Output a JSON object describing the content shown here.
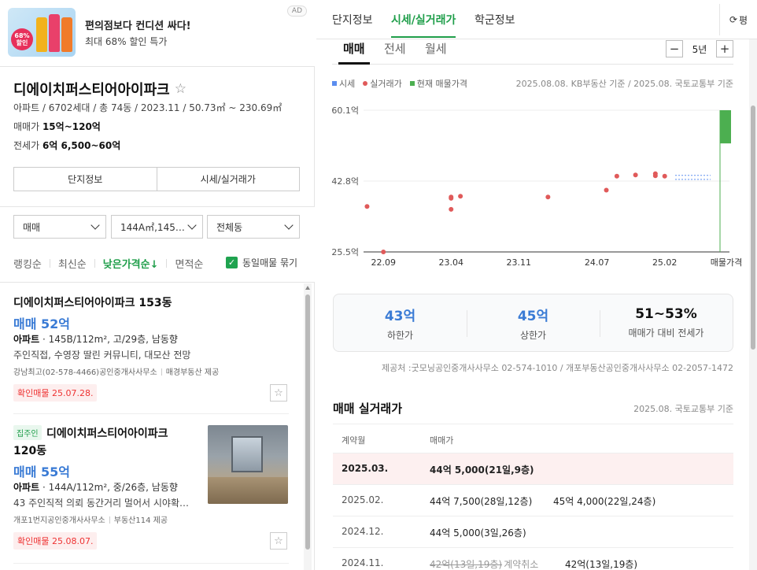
{
  "ad": {
    "title": "편의점보다 컨디션 싸다!",
    "subtitle": "최대 68% 할인 특가",
    "tag": "AD",
    "badge": "68%",
    "badge_sub": "할인"
  },
  "complex": {
    "name": "디에이치퍼스티어아이파크",
    "meta": "아파트 / 6702세대 / 총 74동 / 2023.11 / 50.73㎡ ~ 230.69㎡",
    "sale_label": "매매가",
    "sale_value": "15억~120억",
    "jeonse_label": "전세가",
    "jeonse_value": "6억 6,500~60억",
    "buttons": [
      "단지정보",
      "시세/실거래가"
    ]
  },
  "filters": {
    "trade_type": "매매",
    "area": "144A㎡,145…",
    "building": "전체동",
    "sort_options": [
      "랭킹순",
      "최신순",
      "낮은가격순↓",
      "면적순"
    ],
    "active_sort": "낮은가격순↓",
    "group_label": "동일매물 묶기"
  },
  "listings": [
    {
      "title": "디에이치퍼스티어아이파크 153동",
      "price": "매매 52억",
      "type": "아파트",
      "desc": "145B/112m², 고/29층, 남동향",
      "desc2": "주인직접, 수영장 딸린 커뮤니티, 대모산 전망",
      "agent": "강남최고(02-578-4466)공인중개사사무소",
      "provider": "매경부동산 제공",
      "confirm": "확인매물 25.07.28."
    },
    {
      "tag": "집주인",
      "title_a": "디에이치퍼스티어아이파크",
      "title_b": "120동",
      "price": "매매 55억",
      "type": "아파트",
      "desc": "144A/112m², 중/26층, 남동향",
      "desc2": "43 주인직적 의뢰 동간거리 멀어서 시야확…",
      "agent": "개포1번지공인중개사사무소",
      "provider": "부동산114 제공",
      "confirm": "확인매물 25.08.07."
    }
  ],
  "right": {
    "tabs": [
      "단지정보",
      "시세/실거래가",
      "학군정보"
    ],
    "active_tab": "시세/실거래가",
    "reload_label": "평",
    "subtabs": [
      "매매",
      "전세",
      "월세"
    ],
    "active_subtab": "매매",
    "period": "5년",
    "minus": "−",
    "plus": "+",
    "legend": [
      "시세",
      "실거래가",
      "현재 매물가격"
    ],
    "basis": "2025.08.08. KB부동산 기준 / 2025.08. 국토교통부 기준"
  },
  "colors": {
    "accent": "#1f9e4a",
    "price_blue": "#3a7bd5",
    "deal_red": "#e05a5a",
    "listing_green": "#4caf50",
    "kb_blue": "#5b8def"
  },
  "chart_data": {
    "type": "scatter",
    "title": "",
    "xlabel": "",
    "ylabel": "",
    "y_tick_labels": [
      "60.1억",
      "42.8억",
      "25.5억"
    ],
    "y_ticks": [
      60.1,
      42.8,
      25.5
    ],
    "ylim": [
      25.5,
      60.1
    ],
    "x_tick_labels": [
      "22.09",
      "23.04",
      "23.11",
      "24.07",
      "25.02",
      "매물가격"
    ],
    "x_ticks": [
      2022.67,
      2023.25,
      2023.83,
      2024.5,
      2025.08
    ],
    "xlim": [
      2022.5,
      2025.5
    ],
    "series": [
      {
        "name": "실거래가",
        "color": "#e05a5a",
        "points": [
          [
            2022.53,
            36.6
          ],
          [
            2022.67,
            25.5
          ],
          [
            2023.25,
            38.6
          ],
          [
            2023.25,
            38.9
          ],
          [
            2023.25,
            35.9
          ],
          [
            2023.33,
            39.1
          ],
          [
            2024.08,
            38.9
          ],
          [
            2024.58,
            40.6
          ],
          [
            2024.67,
            44.0
          ],
          [
            2024.83,
            44.3
          ],
          [
            2025.0,
            44.6
          ],
          [
            2025.0,
            44.1
          ],
          [
            2025.08,
            44.0
          ]
        ]
      }
    ],
    "kb_range": {
      "x_from": 2025.17,
      "x_to": 2025.5,
      "low": 43.2,
      "high": 44.2
    },
    "listing_range": {
      "low": 52,
      "high": 60.1
    }
  },
  "stats": [
    {
      "value": "43억",
      "label": "하한가"
    },
    {
      "value": "45억",
      "label": "상한가"
    },
    {
      "value": "51~53%",
      "label": "매매가 대비 전세가"
    }
  ],
  "provider_note": "제공처 :굿모닝공인중개사사무소 02-574-1010 / 개포부동산공인중개사사무소 02-2057-1472",
  "deals": {
    "title": "매매 실거래가",
    "basis": "2025.08. 국토교통부 기준",
    "headers": [
      "계약월",
      "매매가"
    ],
    "rows": [
      {
        "date": "2025.03.",
        "p1": "44억 5,000(21일,9층)",
        "p2": "",
        "highlight": true
      },
      {
        "date": "2025.02.",
        "p1": "44억 7,500(28일,12층)",
        "p2": "45억 4,000(22일,24층)"
      },
      {
        "date": "2024.12.",
        "p1": "44억 5,000(3일,26층)",
        "p2": ""
      },
      {
        "date": "2024.11.",
        "p1_strike": "42억(13일,19층)",
        "p1_cancel": "계약취소",
        "p2": "42억(13일,19층)"
      }
    ]
  }
}
